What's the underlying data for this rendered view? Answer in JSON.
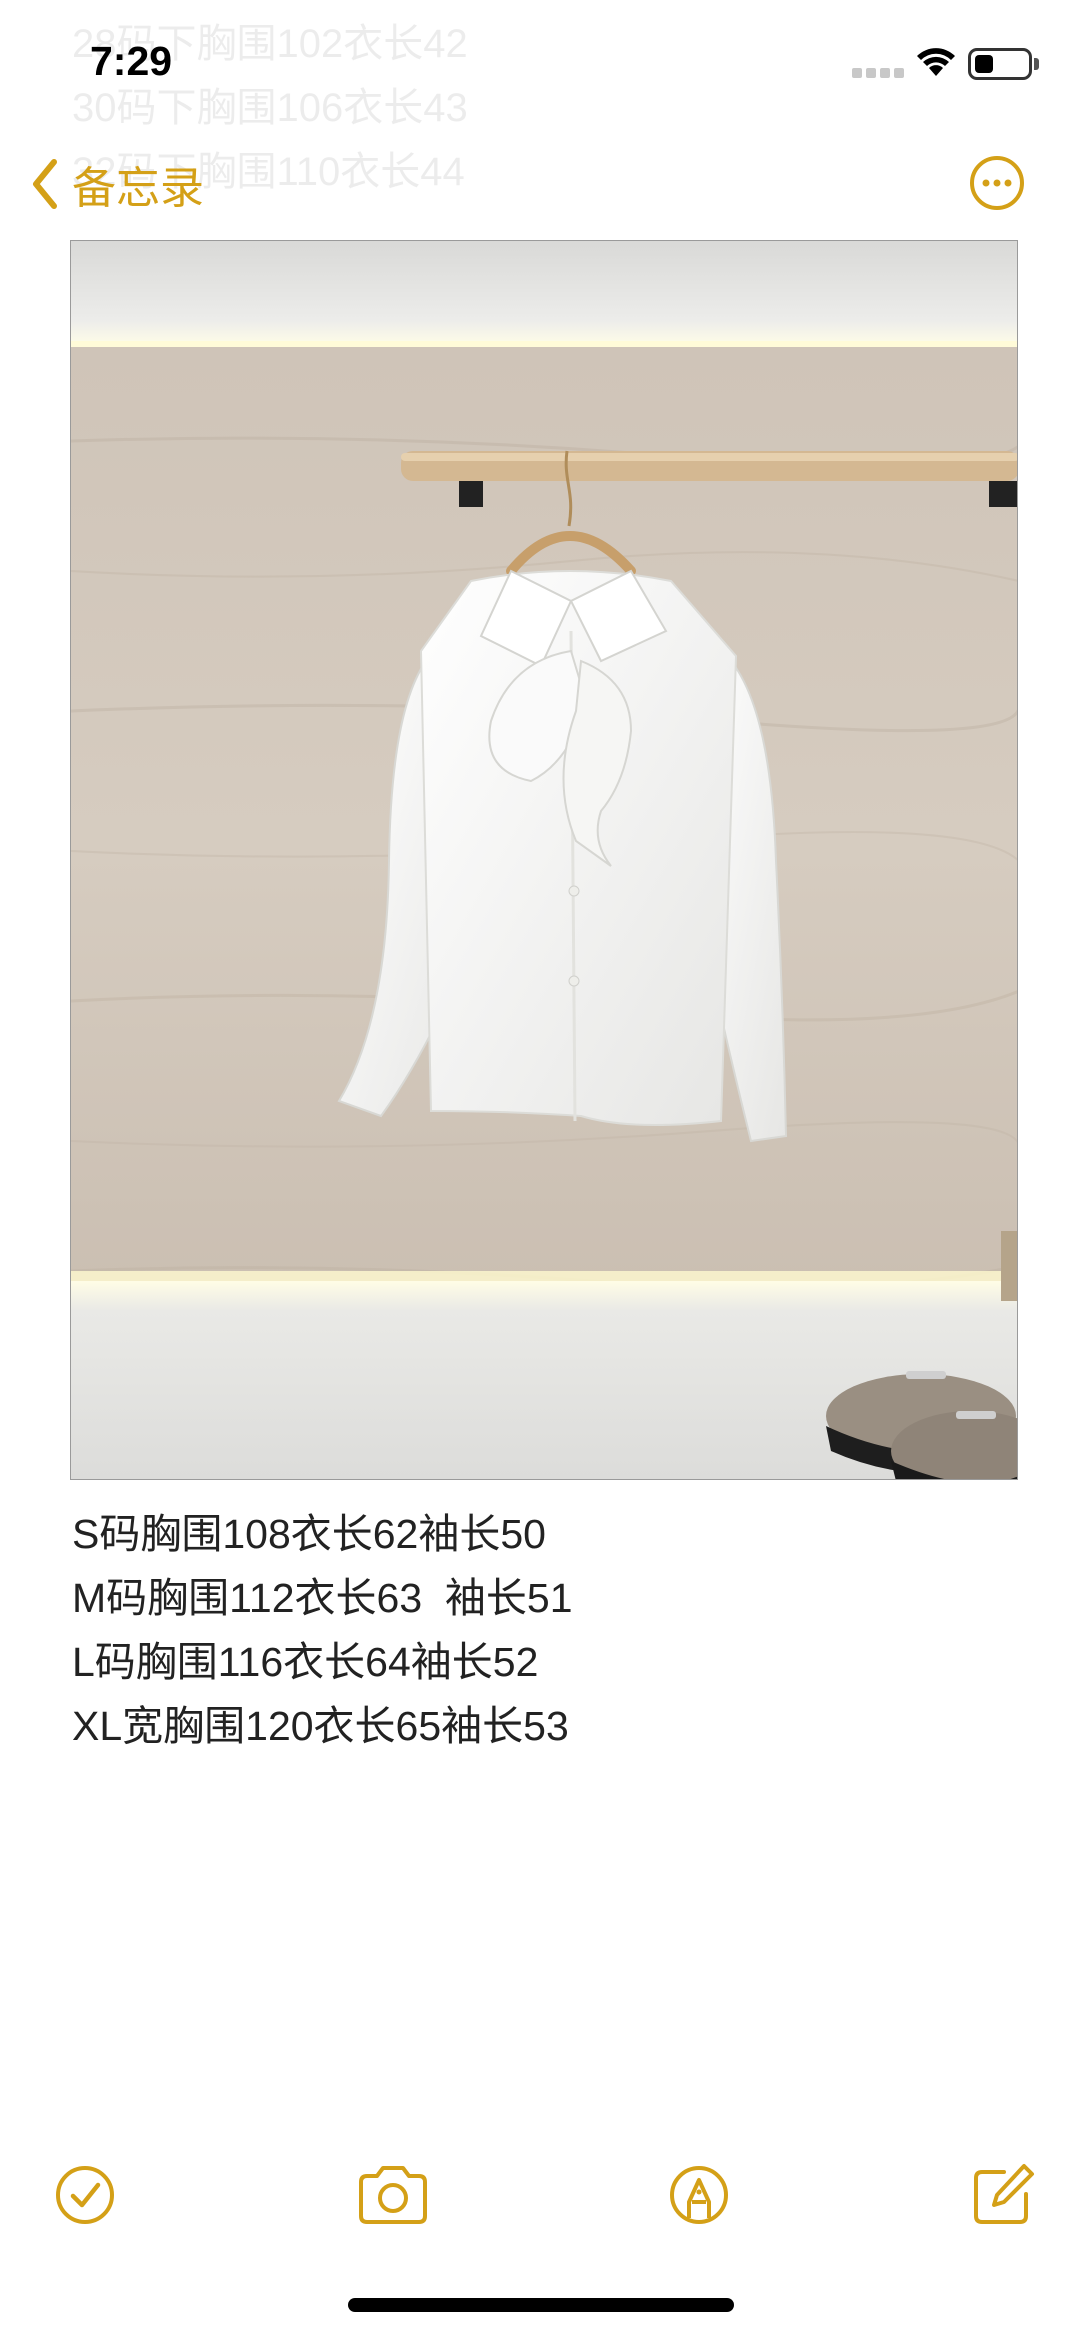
{
  "status_bar": {
    "time": "7:29",
    "battery_level": 0.35
  },
  "background_text": [
    "28码下胸围102衣长42",
    "30码下胸围106衣长43",
    "32码下胸围110衣长44"
  ],
  "nav": {
    "back_label": "备忘录",
    "accent_color": "#D4A017"
  },
  "note": {
    "lines": [
      "S码胸围108衣长62袖长50",
      "M码胸围112衣长63  袖长51",
      "L码胸围116衣长64袖长52",
      "XL宽胸围120衣长65袖长53"
    ]
  },
  "toolbar": {
    "icons": [
      "checklist-icon",
      "camera-icon",
      "markup-icon",
      "compose-icon"
    ]
  }
}
